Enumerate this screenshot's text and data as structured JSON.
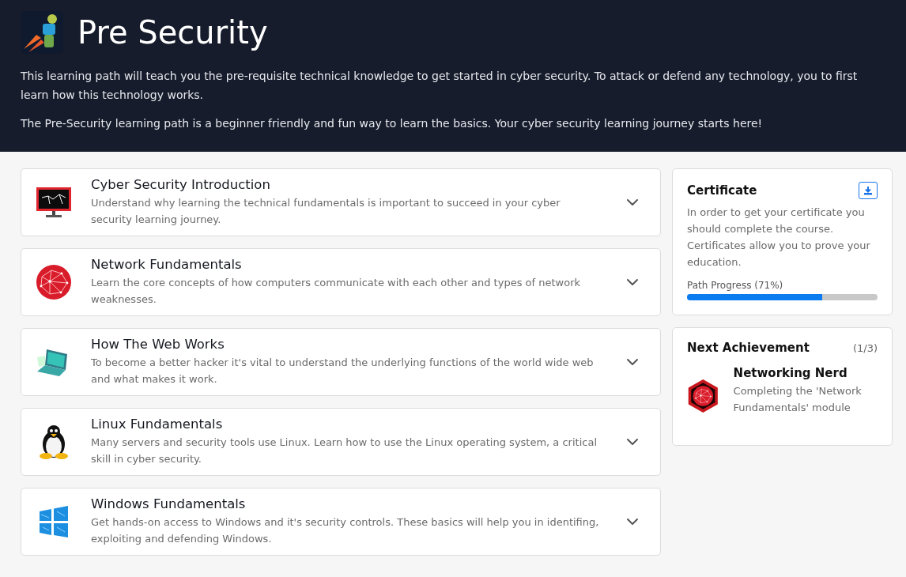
{
  "header": {
    "title": "Pre Security",
    "paragraphs": [
      "This learning path will teach you the pre-requisite technical knowledge to get started in cyber security. To attack or defend any technology, you to first learn how this technology works.",
      "The Pre-Security learning path is a beginner friendly and fun way to learn the basics. Your cyber security learning journey starts here!"
    ]
  },
  "modules": [
    {
      "kind": "monitor",
      "title": "Cyber Security Introduction",
      "description": "Understand why learning the technical fundamentals is important to succeed in your cyber security learning journey.",
      "expanded": false
    },
    {
      "kind": "globe",
      "title": "Network Fundamentals",
      "description": "Learn the core concepts of how computers communicate with each other and types of network weaknesses.",
      "expanded": false
    },
    {
      "kind": "laptop",
      "title": "How The Web Works",
      "description": "To become a better hacker it's vital to understand the underlying functions of the world wide web and what makes it work.",
      "expanded": false
    },
    {
      "kind": "penguin",
      "title": "Linux Fundamentals",
      "description": "Many servers and security tools use Linux. Learn how to use the Linux operating system, a critical skill in cyber security.",
      "expanded": false
    },
    {
      "kind": "windows",
      "title": "Windows Fundamentals",
      "description": "Get hands-on access to Windows and it's security controls. These basics will help you in identifing, exploiting and defending Windows.",
      "expanded": false
    }
  ],
  "certificate": {
    "title": "Certificate",
    "description": "In order to get your certificate you should complete the course. Certificates allow you to prove your education.",
    "progress_label": "Path Progress (71%)",
    "level": 0.71
  },
  "achievement": {
    "title": "Next Achievement",
    "count": "(1/3)",
    "name": "Networking Nerd",
    "description": "Completing the 'Network Fundamentals' module"
  }
}
